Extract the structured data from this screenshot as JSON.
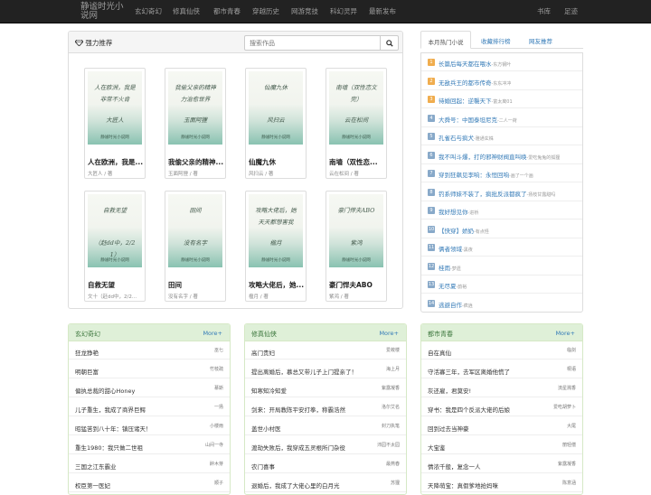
{
  "site": {
    "name": "静谧时光小说网"
  },
  "nav": {
    "items": [
      "玄幻奇幻",
      "修真仙侠",
      "都市青春",
      "穿越历史",
      "网游竞技",
      "科幻灵异",
      "最新发布"
    ],
    "right_items": [
      "书库",
      "足迹"
    ]
  },
  "featured": {
    "title": "强力推荐",
    "search_placeholder": "搜索作品",
    "books": [
      {
        "title": "人在欧洲，我是...",
        "author": "大匠人 / 著",
        "cover_title": "人在欧洲，我是非常不火肯",
        "cover_sub": "大匠人"
      },
      {
        "title": "我偷父亲的精神...",
        "author": "玉面阿狸 / 著",
        "cover_title": "我偷父亲的精神力治愈世界",
        "cover_sub": "玉面阿狸"
      },
      {
        "title": "仙魔九休",
        "author": "风扫云 / 著",
        "cover_title": "仙魔九休",
        "cover_sub": "风扫云"
      },
      {
        "title": "南墙（双性恋...",
        "author": "云在松间 / 著",
        "cover_title": "南墙（双性恋文完）",
        "cover_sub": "云在松间"
      },
      {
        "title": "自救无望",
        "author": "文十（赶dd中，2/2...",
        "cover_title": "自救无望",
        "cover_sub": "（赶dd中，2/21）"
      },
      {
        "title": "田间",
        "author": "没有名字 / 著",
        "cover_title": "田间",
        "cover_sub": "没有名字"
      },
      {
        "title": "攻略大佬后，她...",
        "author": "楹月 / 著",
        "cover_title": "攻略大佬后，她天天都想害我",
        "cover_sub": "楹月"
      },
      {
        "title": "豪门悍夫ABO",
        "author": "紫鸿 / 著",
        "cover_title": "豪门悍夫ABO",
        "cover_sub": "紫鸿"
      }
    ],
    "cover_footer": "静谧时光小说网"
  },
  "ranking": {
    "tabs": [
      "本月热门小说",
      "收藏排行榜",
      "网友推荐"
    ],
    "items": [
      {
        "rank": "1",
        "title": "长篇后每天都在喂水",
        "author": "-东方钢叶"
      },
      {
        "rank": "2",
        "title": "无敌兵王的都市传奇",
        "author": "-东东冲冲"
      },
      {
        "rank": "3",
        "title": "待婚回起：逆襲天下",
        "author": "-富太离01"
      },
      {
        "rank": "4",
        "title": "大舜号：中国泰坦尼克",
        "author": "-二人一荷"
      },
      {
        "rank": "5",
        "title": "孔雀石与疯犬",
        "author": "-雅通玄株"
      },
      {
        "rank": "6",
        "title": "我不叫斗爆，打的邪神财阀直叫唤",
        "author": "-爱吃兔兔的狐狸"
      },
      {
        "rank": "7",
        "title": "穿到狂飙见李响：永恒回响",
        "author": "-画了一个画"
      },
      {
        "rank": "8",
        "title": "钓系师妹不装了，疯批反派都疯了",
        "author": "-扬枝甘露甜吗"
      },
      {
        "rank": "9",
        "title": "我好想见你",
        "author": "-进桥"
      },
      {
        "rank": "10",
        "title": "【快穿】娇奶",
        "author": "-有点怪"
      },
      {
        "rank": "11",
        "title": "俩者领域",
        "author": "-黑夜"
      },
      {
        "rank": "12",
        "title": "桂雨",
        "author": "-梦遗"
      },
      {
        "rank": "13",
        "title": "无尽夏",
        "author": "-韵裕"
      },
      {
        "rank": "14",
        "title": "逃避自作",
        "author": "-疯逍"
      }
    ]
  },
  "categories": [
    {
      "title": "玄幻奇幻",
      "more": "More+",
      "items": [
        {
          "name": "狂龙狰艳",
          "author": "巫七"
        },
        {
          "name": "明朝巨富",
          "author": "竹枝疏"
        },
        {
          "name": "偏执总裁的甜心Honey",
          "author": "慕斯"
        },
        {
          "name": "儿子重生，我成了商界巨鳄",
          "author": "一扬"
        },
        {
          "name": "昭猛苦到八十年：镇压诸天！",
          "author": "小楼雨"
        },
        {
          "name": "重生1980：我只做二世祖",
          "author": "山间一寺"
        },
        {
          "name": "三国之江东霸业",
          "author": "醉木芽"
        },
        {
          "name": "权臣第一医妃",
          "author": "顺子"
        }
      ]
    },
    {
      "title": "修真仙侠",
      "more": "More+",
      "items": [
        {
          "name": "高门贵妇",
          "author": "爱莜楼"
        },
        {
          "name": "提出离婚后，慕总又带儿子上门提亲了！",
          "author": "海上月"
        },
        {
          "name": "知寒知冷知爱",
          "author": "紫露凝香"
        },
        {
          "name": "剑来：开局教陈平安打拳，称霸浩然",
          "author": "洛尔艾名"
        },
        {
          "name": "盖世小村医",
          "author": "封刀执笔"
        },
        {
          "name": "渡劫失败后，我穿成五灵根所门杂役",
          "author": "沛园不太园"
        },
        {
          "name": "农门喜事",
          "author": "最燕春"
        },
        {
          "name": "退婚后，我成了大佬心里的白月光",
          "author": "苏狸"
        }
      ]
    },
    {
      "title": "都市青春",
      "more": "More+",
      "items": [
        {
          "name": "自在真仙",
          "author": "临剑"
        },
        {
          "name": "守活寡三年，去军区离婚他慌了",
          "author": "桐语"
        },
        {
          "name": "灰还雇，君莫安!",
          "author": "流星溅香"
        },
        {
          "name": "穿书：我是四个反派大佬的后娘",
          "author": "爱吃胡萝卜"
        },
        {
          "name": "回到过去当神豪",
          "author": "大尾"
        },
        {
          "name": "大宝鉴",
          "author": "丽轻偿"
        },
        {
          "name": "情浓千般，复念一人",
          "author": "紫露凝香"
        },
        {
          "name": "天降萌宝：真假爹地抢妈咪",
          "author": "陈意涵"
        }
      ]
    }
  ],
  "colors": {
    "nav_bg": "#222222",
    "link": "#337ab7",
    "cat_head": "#dff0d8",
    "rank_top": "#f0ad4e",
    "rank_other": "#88a9c9"
  }
}
